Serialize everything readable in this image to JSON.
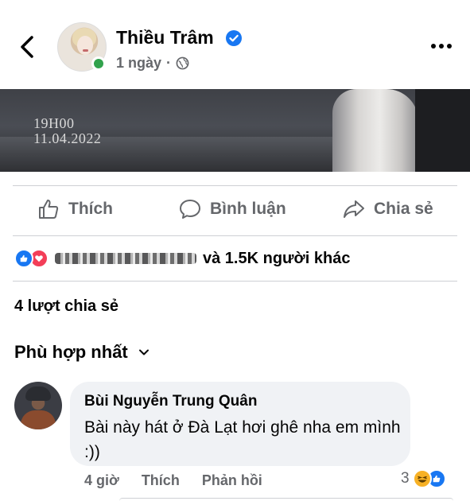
{
  "post": {
    "author_name": "Thiều Trâm",
    "time_ago": "1 ngày",
    "separator": "·",
    "image_text_time": "19H00",
    "image_text_date": "11.04.2022"
  },
  "actions": {
    "like_label": "Thích",
    "comment_label": "Bình luận",
    "share_label": "Chia sẻ"
  },
  "reactions": {
    "summary_text": "và 1.5K người khác"
  },
  "shares": {
    "label": "4 lượt chia sẻ"
  },
  "comments_sort": {
    "label": "Phù hợp nhất"
  },
  "comment": {
    "author": "Bùi Nguyễn Trung Quân",
    "text": "Bài này hát ở Đà Lạt hơi ghê nha em mình :))",
    "time_ago": "4 giờ",
    "like_label": "Thích",
    "reply_label": "Phản hồi",
    "reaction_count": "3"
  },
  "colors": {
    "accent": "#1877f2",
    "online": "#31a24c",
    "love": "#f33e58",
    "haha": "#f7b125",
    "secondary_text": "#65676b"
  }
}
